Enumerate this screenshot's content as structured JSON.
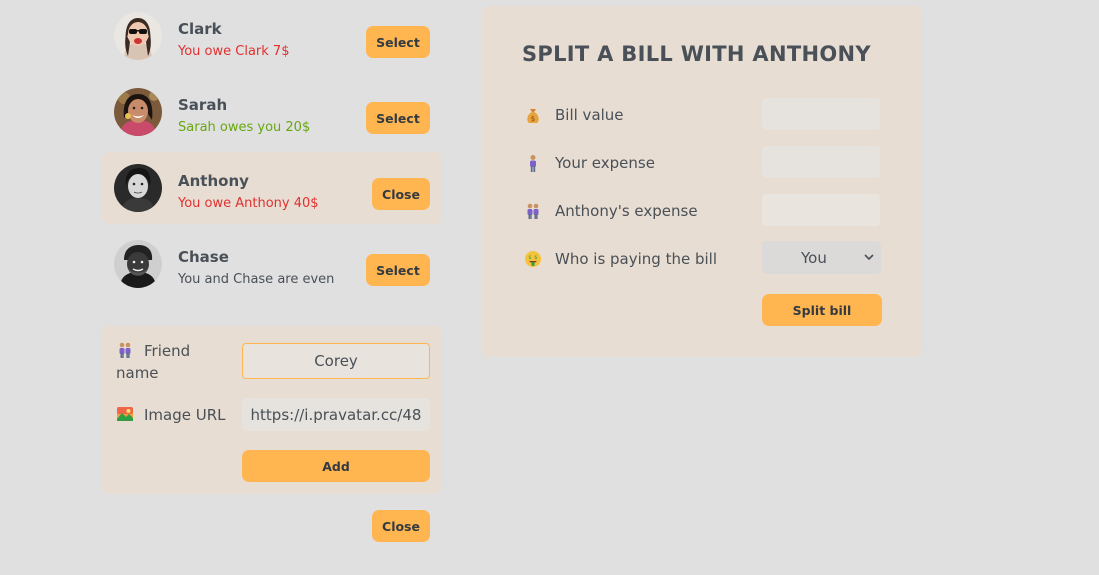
{
  "friends": [
    {
      "name": "Clark",
      "status": "You owe Clark 7$",
      "status_kind": "negative",
      "button": "Select",
      "selected": false
    },
    {
      "name": "Sarah",
      "status": "Sarah owes you 20$",
      "status_kind": "positive",
      "button": "Select",
      "selected": false
    },
    {
      "name": "Anthony",
      "status": "You owe Anthony 40$",
      "status_kind": "negative",
      "button": "Close",
      "selected": true
    },
    {
      "name": "Chase",
      "status": "You and Chase are even",
      "status_kind": "even",
      "button": "Select",
      "selected": false
    }
  ],
  "add_friend": {
    "name_label": "Friend name",
    "name_icon": "people-icon",
    "name_value": "Corey",
    "image_label": "Image URL",
    "image_icon": "image-icon",
    "image_value": "https://i.pravatar.cc/48",
    "add_label": "Add"
  },
  "close_form_label": "Close",
  "split": {
    "title": "SPLIT A BILL WITH ANTHONY",
    "bill_label": "Bill value",
    "bill_icon": "money-bag-icon",
    "bill_value": "",
    "your_expense_label": "Your expense",
    "your_expense_icon": "person-icon",
    "your_expense_value": "",
    "friend_expense_label": "Anthony's expense",
    "friend_expense_icon": "people-icon",
    "friend_expense_value": "",
    "payer_label": "Who is paying the bill",
    "payer_icon": "money-face-icon",
    "payer_value": "You",
    "submit_label": "Split bill"
  },
  "colors": {
    "accent": "#ffb651",
    "panel": "#e8ddd2",
    "background": "#e0e0e0",
    "negative": "#e03131",
    "positive": "#66a80f",
    "text": "#495057"
  }
}
